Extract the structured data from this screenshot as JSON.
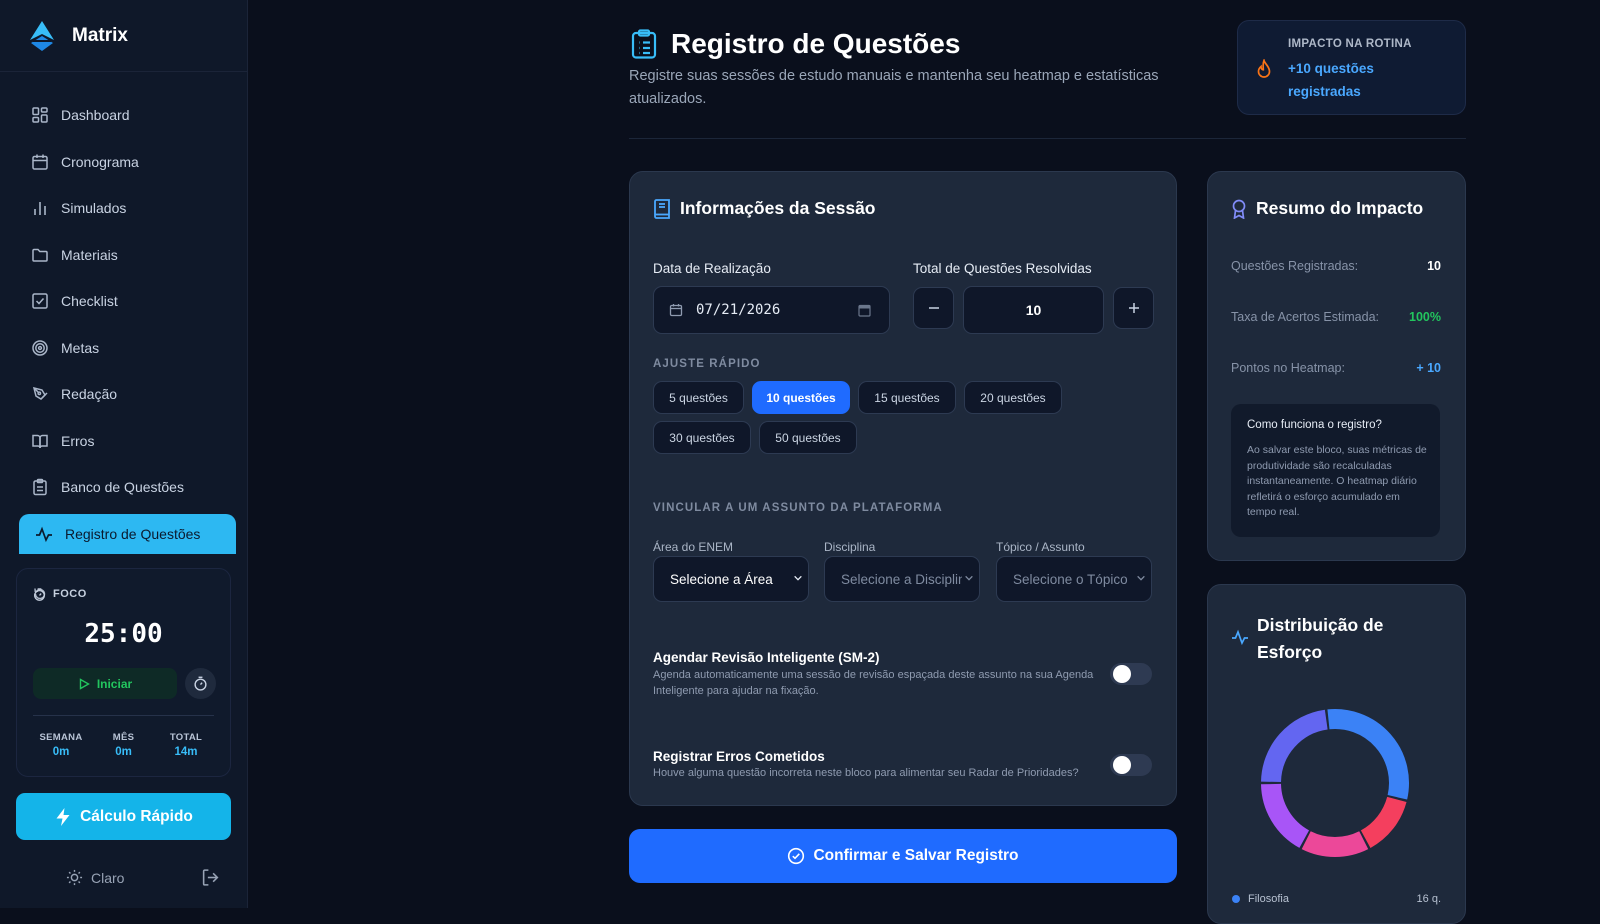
{
  "app": {
    "name": "Matrix"
  },
  "sidebar": {
    "items": [
      {
        "label": "Dashboard",
        "icon": "grid-icon"
      },
      {
        "label": "Cronograma",
        "icon": "calendar-icon"
      },
      {
        "label": "Simulados",
        "icon": "bar-chart-icon"
      },
      {
        "label": "Materiais",
        "icon": "folder-icon"
      },
      {
        "label": "Checklist",
        "icon": "checkbox-icon"
      },
      {
        "label": "Metas",
        "icon": "target-icon"
      },
      {
        "label": "Redação",
        "icon": "pen-icon"
      },
      {
        "label": "Erros",
        "icon": "book-open-icon"
      },
      {
        "label": "Banco de Questões",
        "icon": "clipboard-icon"
      },
      {
        "label": "Registro de Questões",
        "icon": "activity-icon",
        "active": true
      }
    ]
  },
  "focus": {
    "label": "FOCO",
    "time": "25:00",
    "start_label": "Iniciar",
    "stats": [
      {
        "key": "SEMANA",
        "value": "0m"
      },
      {
        "key": "MÊS",
        "value": "0m"
      },
      {
        "key": "TOTAL",
        "value": "14m"
      }
    ]
  },
  "quick_calc_label": "Cálculo Rápido",
  "theme_label": "Claro",
  "header": {
    "title": "Registro de Questões",
    "subtitle": "Registre suas sessões de estudo manuais e mantenha seu heatmap e estatísticas atualizados."
  },
  "impact": {
    "title": "IMPACTO NA ROTINA",
    "value": "+10 questões registradas"
  },
  "session": {
    "title": "Informações da Sessão",
    "date_label": "Data de Realização",
    "date_value": "07/21/2026",
    "total_label": "Total de Questões Resolvidas",
    "total_value": "10",
    "quick_label": "AJUSTE RÁPIDO",
    "chips": [
      "5 questões",
      "10 questões",
      "15 questões",
      "20 questões",
      "30 questões",
      "50 questões"
    ],
    "selected_chip": "10 questões",
    "link_label": "VINCULAR A UM ASSUNTO DA PLATAFORMA",
    "area_label": "Área do ENEM",
    "area_value": "Selecione a Área",
    "disc_label": "Disciplina",
    "disc_value": "Selecione a Disciplina",
    "topic_label": "Tópico / Assunto",
    "topic_value": "Selecione o Tópico",
    "review_title": "Agendar Revisão Inteligente (SM-2)",
    "review_desc": "Agenda automaticamente uma sessão de revisão espaçada deste assunto na sua Agenda Inteligente para ajudar na fixação.",
    "review_on": false,
    "errors_title": "Registrar Erros Cometidos",
    "errors_desc": "Houve alguma questão incorreta neste bloco para alimentar seu Radar de Prioridades?",
    "errors_on": false
  },
  "confirm_label": "Confirmar e Salvar Registro",
  "summary": {
    "title": "Resumo do Impacto",
    "rows": [
      {
        "label": "Questões Registradas:",
        "value": "10",
        "color": "#ffffff"
      },
      {
        "label": "Taxa de Acertos Estimada:",
        "value": "100%",
        "color": "#22c55e"
      },
      {
        "label": "Pontos no Heatmap:",
        "value": "+ 10",
        "color": "#4aa8ff"
      }
    ],
    "how_title": "Como funciona o registro?",
    "how_desc": "Ao salvar este bloco, suas métricas de produtividade são recalculadas instantaneamente. O heatmap diário refletirá o esforço acumulado em tempo real."
  },
  "distribution": {
    "title": "Distribuição de Esforço",
    "legend": [
      {
        "name": "Filosofia",
        "value": "16 q.",
        "color": "#3b82f6"
      }
    ]
  },
  "chart_data": {
    "type": "pie",
    "title": "Distribuição de Esforço",
    "slices": [
      {
        "name": "Filosofia",
        "value": 16,
        "color": "#3b82f6"
      },
      {
        "name": "",
        "value": 7,
        "color": "#f43f5e"
      },
      {
        "name": "",
        "value": 8,
        "color": "#ec4899"
      },
      {
        "name": "",
        "value": 9,
        "color": "#a855f7"
      },
      {
        "name": "",
        "value": 12,
        "color": "#6366f1"
      }
    ]
  },
  "colors": {
    "accent": "#1f6bff",
    "active_nav": "#2db8f2",
    "quick_calc": "#14b4e9",
    "success": "#22c55e"
  }
}
